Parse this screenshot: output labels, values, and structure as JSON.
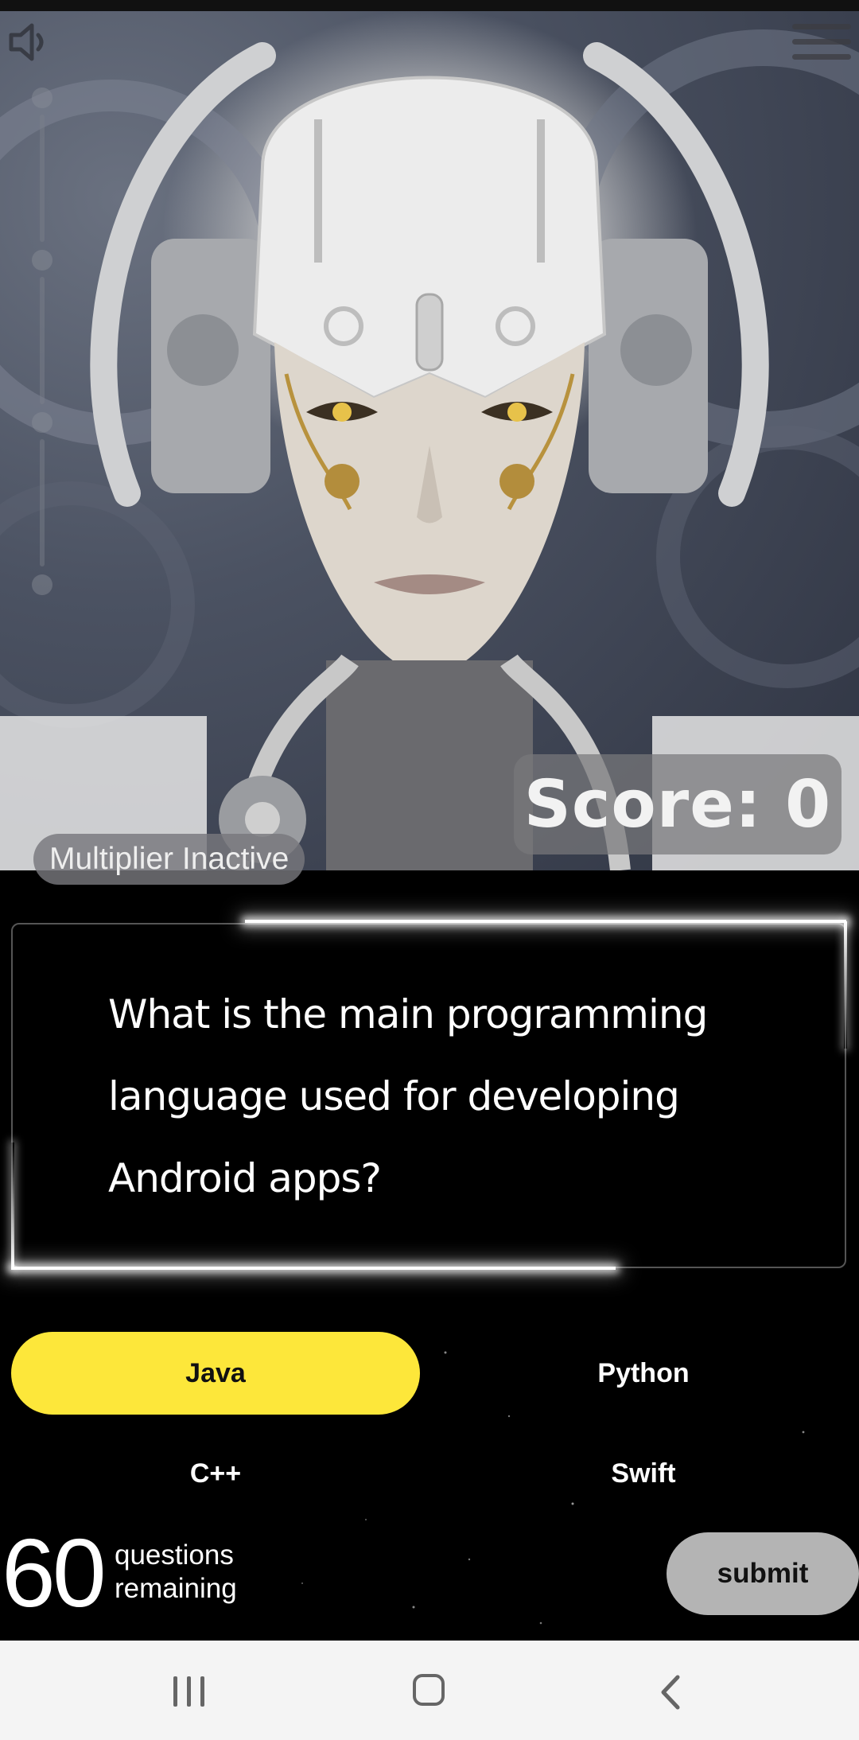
{
  "hud": {
    "score_text": "Score: 0",
    "multiplier_text": "Multiplier Inactive",
    "icons": {
      "mute": "speaker-muted-icon",
      "menu": "hamburger-menu-icon"
    }
  },
  "question": {
    "text": "What is the main programming language used for developing Android apps?"
  },
  "answers": [
    {
      "label": "Java",
      "selected": true
    },
    {
      "label": "Python",
      "selected": false
    },
    {
      "label": "C++",
      "selected": false
    },
    {
      "label": "Swift",
      "selected": false
    }
  ],
  "footer": {
    "remaining_count": "60",
    "remaining_label_1": "questions",
    "remaining_label_2": "remaining",
    "submit_label": "submit"
  },
  "colors": {
    "selected_answer": "#fde73a",
    "submit_button": "#b4b4b4",
    "background": "#000000"
  },
  "system_nav": {
    "icons": [
      "recent-apps-icon",
      "home-icon",
      "back-icon"
    ]
  }
}
